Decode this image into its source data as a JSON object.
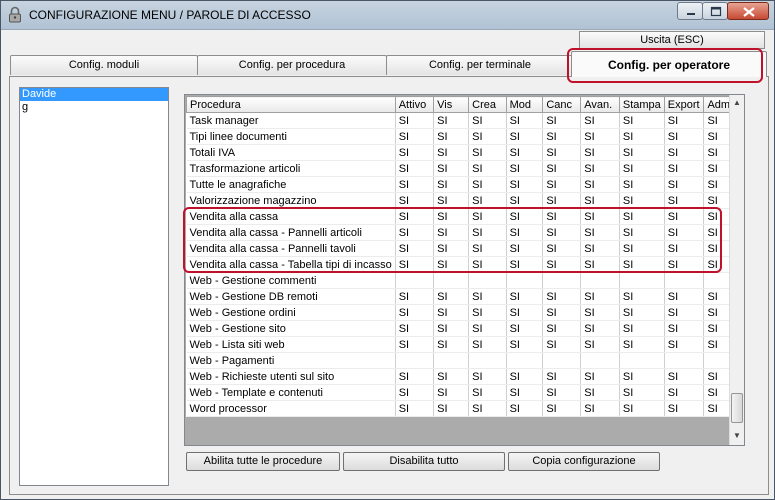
{
  "window": {
    "title": "CONFIGURAZIONE MENU / PAROLE DI ACCESSO",
    "icon": "padlock-icon"
  },
  "colors": {
    "highlight": "#c0112b",
    "selection": "#3399ff"
  },
  "tabs": [
    {
      "label": "Config. moduli",
      "active": false
    },
    {
      "label": "Config. per procedura",
      "active": false
    },
    {
      "label": "Config. per terminale",
      "active": false
    },
    {
      "label": "Config. per operatore",
      "active": true
    }
  ],
  "exit_button": "Uscita (ESC)",
  "operators": [
    {
      "name": "Davide",
      "selected": true
    },
    {
      "name": "g",
      "selected": false
    }
  ],
  "grid": {
    "columns": [
      "Procedura",
      "Attivo",
      "Vis",
      "Crea",
      "Mod",
      "Canc",
      "Avan.",
      "Stampa",
      "Export",
      "Admin"
    ],
    "rows": [
      [
        "Task manager",
        "SI",
        "SI",
        "SI",
        "SI",
        "SI",
        "SI",
        "SI",
        "SI",
        "SI"
      ],
      [
        "Tipi linee documenti",
        "SI",
        "SI",
        "SI",
        "SI",
        "SI",
        "SI",
        "SI",
        "SI",
        "SI"
      ],
      [
        "Totali IVA",
        "SI",
        "SI",
        "SI",
        "SI",
        "SI",
        "SI",
        "SI",
        "SI",
        "SI"
      ],
      [
        "Trasformazione articoli",
        "SI",
        "SI",
        "SI",
        "SI",
        "SI",
        "SI",
        "SI",
        "SI",
        "SI"
      ],
      [
        "Tutte le anagrafiche",
        "SI",
        "SI",
        "SI",
        "SI",
        "SI",
        "SI",
        "SI",
        "SI",
        "SI"
      ],
      [
        "Valorizzazione magazzino",
        "SI",
        "SI",
        "SI",
        "SI",
        "SI",
        "SI",
        "SI",
        "SI",
        "SI"
      ],
      [
        "Vendita alla cassa",
        "SI",
        "SI",
        "SI",
        "SI",
        "SI",
        "SI",
        "SI",
        "SI",
        "SI"
      ],
      [
        "Vendita alla cassa - Pannelli articoli",
        "SI",
        "SI",
        "SI",
        "SI",
        "SI",
        "SI",
        "SI",
        "SI",
        "SI"
      ],
      [
        "Vendita alla cassa - Pannelli tavoli",
        "SI",
        "SI",
        "SI",
        "SI",
        "SI",
        "SI",
        "SI",
        "SI",
        "SI"
      ],
      [
        "Vendita alla cassa - Tabella tipi di incasso",
        "SI",
        "SI",
        "SI",
        "SI",
        "SI",
        "SI",
        "SI",
        "SI",
        "SI"
      ],
      [
        "Web - Gestione commenti",
        "",
        "",
        "",
        "",
        "",
        "",
        "",
        "",
        ""
      ],
      [
        "Web - Gestione DB remoti",
        "SI",
        "SI",
        "SI",
        "SI",
        "SI",
        "SI",
        "SI",
        "SI",
        "SI"
      ],
      [
        "Web - Gestione ordini",
        "SI",
        "SI",
        "SI",
        "SI",
        "SI",
        "SI",
        "SI",
        "SI",
        "SI"
      ],
      [
        "Web - Gestione sito",
        "SI",
        "SI",
        "SI",
        "SI",
        "SI",
        "SI",
        "SI",
        "SI",
        "SI"
      ],
      [
        "Web - Lista siti web",
        "SI",
        "SI",
        "SI",
        "SI",
        "SI",
        "SI",
        "SI",
        "SI",
        "SI"
      ],
      [
        "Web - Pagamenti",
        "",
        "",
        "",
        "",
        "",
        "",
        "",
        "",
        ""
      ],
      [
        "Web - Richieste utenti sul sito",
        "SI",
        "SI",
        "SI",
        "SI",
        "SI",
        "SI",
        "SI",
        "SI",
        "SI"
      ],
      [
        "Web - Template e contenuti",
        "SI",
        "SI",
        "SI",
        "SI",
        "SI",
        "SI",
        "SI",
        "SI",
        "SI"
      ],
      [
        "Word processor",
        "SI",
        "SI",
        "SI",
        "SI",
        "SI",
        "SI",
        "SI",
        "SI",
        "SI"
      ]
    ]
  },
  "buttons": {
    "enable_all": "Abilita tutte le procedure",
    "disable_all": "Disabilita tutto",
    "copy_config": "Copia configurazione"
  }
}
